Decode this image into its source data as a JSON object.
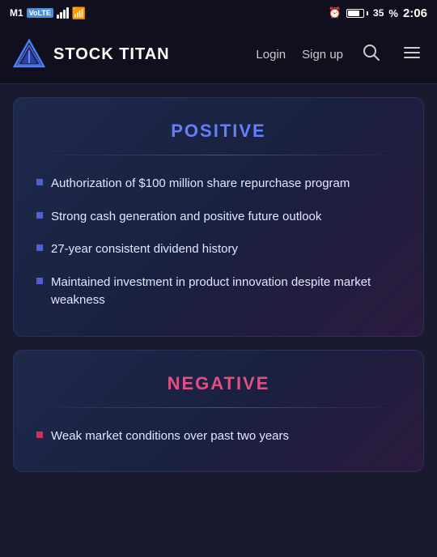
{
  "statusBar": {
    "carrier": "M1",
    "network": "VoLTE",
    "time": "2:06",
    "battery": "35"
  },
  "navbar": {
    "brand": "STOCK TITAN",
    "loginLabel": "Login",
    "signupLabel": "Sign up",
    "searchIcon": "search-icon",
    "menuIcon": "menu-icon"
  },
  "positiveCard": {
    "title": "Positive",
    "items": [
      "Authorization of $100 million share repurchase program",
      "Strong cash generation and positive future outlook",
      "27-year consistent dividend history",
      "Maintained investment in product innovation despite market weakness"
    ]
  },
  "negativeCard": {
    "title": "Negative",
    "items": [
      "Weak market conditions over past two years"
    ]
  }
}
